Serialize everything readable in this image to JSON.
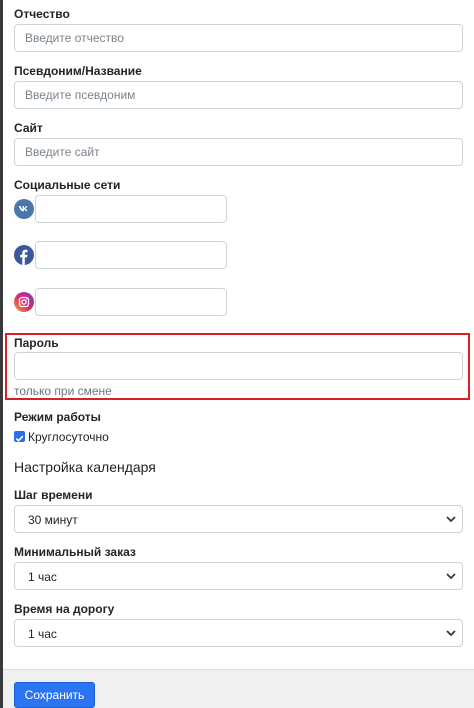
{
  "fields": {
    "patronymic": {
      "label": "Отчество",
      "placeholder": "Введите отчество"
    },
    "nickname": {
      "label": "Псевдоним/Название",
      "placeholder": "Введите псевдоним"
    },
    "site": {
      "label": "Сайт",
      "placeholder": "Введите сайт"
    }
  },
  "social": {
    "label": "Социальные сети",
    "networks": [
      {
        "icon": "vk-icon",
        "color": "#4a76a8"
      },
      {
        "icon": "facebook-icon",
        "color": "#3b5998"
      },
      {
        "icon": "instagram-icon",
        "color": "#c13584"
      }
    ]
  },
  "password": {
    "label": "Пароль",
    "help": "только при смене",
    "highlight_color": "#d92027"
  },
  "work_mode": {
    "label": "Режим работы",
    "checkbox_label": "Круглосуточно",
    "checked": true
  },
  "calendar": {
    "heading": "Настройка календаря",
    "time_step": {
      "label": "Шаг времени",
      "value": "30 минут"
    },
    "min_order": {
      "label": "Минимальный заказ",
      "value": "1 час"
    },
    "travel_time": {
      "label": "Время на дорогу",
      "value": "1 час"
    }
  },
  "footer": {
    "save_label": "Сохранить",
    "button_color": "#2b74f2"
  }
}
